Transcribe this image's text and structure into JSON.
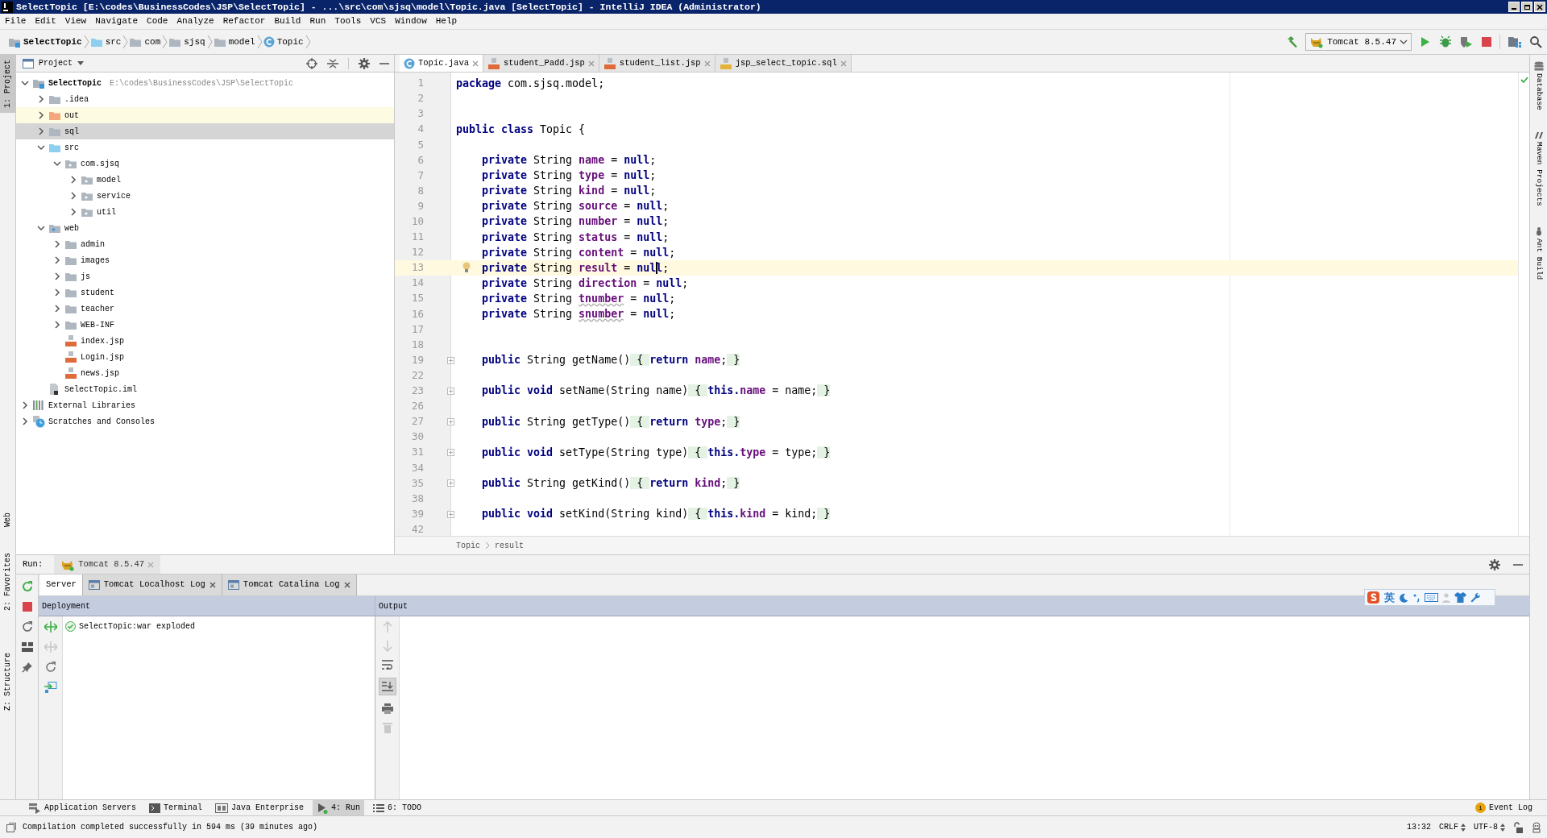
{
  "window": {
    "title": "SelectTopic [E:\\codes\\BusinessCodes\\JSP\\SelectTopic] - ...\\src\\com\\sjsq\\model\\Topic.java [SelectTopic] - IntelliJ IDEA (Administrator)"
  },
  "menu": [
    "File",
    "Edit",
    "View",
    "Navigate",
    "Code",
    "Analyze",
    "Refactor",
    "Build",
    "Run",
    "Tools",
    "VCS",
    "Window",
    "Help"
  ],
  "nav_bar": [
    {
      "label": "SelectTopic",
      "kind": "module"
    },
    {
      "label": "src",
      "kind": "source"
    },
    {
      "label": "com",
      "kind": "folder"
    },
    {
      "label": "sjsq",
      "kind": "folder"
    },
    {
      "label": "model",
      "kind": "folder"
    },
    {
      "label": "Topic",
      "kind": "class"
    }
  ],
  "run_config": "Tomcat 8.5.47",
  "left_stripe": [
    {
      "label": "1: Project",
      "selected": true
    },
    {
      "label": "Web",
      "selected": false
    },
    {
      "label": "2: Favorites",
      "selected": false
    },
    {
      "label": "Z: Structure",
      "selected": false
    }
  ],
  "right_stripe": [
    "Database",
    "Maven Projects",
    "Ant Build"
  ],
  "project": {
    "title": "Project",
    "tree": [
      {
        "label": "SelectTopic",
        "path": "E:\\codes\\BusinessCodes\\JSP\\SelectTopic",
        "kind": "module",
        "expanded": true,
        "selected": false,
        "children": [
          {
            "label": ".idea",
            "kind": "folder",
            "expanded": false,
            "selected": false
          },
          {
            "label": "out",
            "kind": "excluded",
            "expanded": false,
            "selected": false
          },
          {
            "label": "sql",
            "kind": "folder",
            "expanded": false,
            "selected": true
          },
          {
            "label": "src",
            "kind": "source",
            "expanded": true,
            "selected": false,
            "children": [
              {
                "label": "com.sjsq",
                "kind": "package",
                "expanded": true,
                "selected": false,
                "children": [
                  {
                    "label": "model",
                    "kind": "package",
                    "expanded": false,
                    "selected": false
                  },
                  {
                    "label": "service",
                    "kind": "package",
                    "expanded": false,
                    "selected": false
                  },
                  {
                    "label": "util",
                    "kind": "package",
                    "expanded": false,
                    "selected": false
                  }
                ]
              }
            ]
          },
          {
            "label": "web",
            "kind": "web",
            "expanded": true,
            "selected": false,
            "children": [
              {
                "label": "admin",
                "kind": "folder",
                "expanded": false,
                "selected": false
              },
              {
                "label": "images",
                "kind": "folder",
                "expanded": false,
                "selected": false
              },
              {
                "label": "js",
                "kind": "folder",
                "expanded": false,
                "selected": false
              },
              {
                "label": "student",
                "kind": "folder",
                "expanded": false,
                "selected": false
              },
              {
                "label": "teacher",
                "kind": "folder",
                "expanded": false,
                "selected": false
              },
              {
                "label": "WEB-INF",
                "kind": "folder",
                "expanded": false,
                "selected": false
              },
              {
                "label": "index.jsp",
                "kind": "jsp",
                "selected": false
              },
              {
                "label": "Login.jsp",
                "kind": "jsp",
                "selected": false
              },
              {
                "label": "news.jsp",
                "kind": "jsp",
                "selected": false
              }
            ]
          },
          {
            "label": "SelectTopic.iml",
            "kind": "iml",
            "selected": false
          }
        ]
      },
      {
        "label": "External Libraries",
        "kind": "libraries",
        "expanded": false,
        "selected": false
      },
      {
        "label": "Scratches and Consoles",
        "kind": "scratches",
        "expanded": false,
        "selected": false
      }
    ]
  },
  "editor_tabs": [
    {
      "label": "Topic.java",
      "kind": "class",
      "selected": true
    },
    {
      "label": "student_Padd.jsp",
      "kind": "jsp",
      "selected": false
    },
    {
      "label": "student_list.jsp",
      "kind": "jsp",
      "selected": false
    },
    {
      "label": "jsp_select_topic.sql",
      "kind": "sql",
      "selected": false
    }
  ],
  "code": [
    {
      "number": "1",
      "tokens": [
        {
          "kind": "kw",
          "text": "package"
        },
        {
          "kind": "plain",
          "text": " com.sjsq.model;"
        }
      ]
    },
    {
      "number": "2"
    },
    {
      "number": "3"
    },
    {
      "number": "4",
      "tokens": [
        {
          "kind": "kw",
          "text": "public class"
        },
        {
          "kind": "plain",
          "text": " Topic {"
        }
      ]
    },
    {
      "number": "5"
    },
    {
      "number": "6",
      "tokens": [
        {
          "kind": "kw",
          "text": "    private"
        },
        {
          "kind": "plain",
          "text": " String "
        },
        {
          "kind": "field",
          "text": "name"
        },
        {
          "kind": "plain",
          "text": " = "
        },
        {
          "kind": "kw",
          "text": "null"
        },
        {
          "kind": "plain",
          "text": ";"
        }
      ]
    },
    {
      "number": "7",
      "tokens": [
        {
          "kind": "kw",
          "text": "    private"
        },
        {
          "kind": "plain",
          "text": " String "
        },
        {
          "kind": "field",
          "text": "type"
        },
        {
          "kind": "plain",
          "text": " = "
        },
        {
          "kind": "kw",
          "text": "null"
        },
        {
          "kind": "plain",
          "text": ";"
        }
      ]
    },
    {
      "number": "8",
      "tokens": [
        {
          "kind": "kw",
          "text": "    private"
        },
        {
          "kind": "plain",
          "text": " String "
        },
        {
          "kind": "field",
          "text": "kind"
        },
        {
          "kind": "plain",
          "text": " = "
        },
        {
          "kind": "kw",
          "text": "null"
        },
        {
          "kind": "plain",
          "text": ";"
        }
      ]
    },
    {
      "number": "9",
      "tokens": [
        {
          "kind": "kw",
          "text": "    private"
        },
        {
          "kind": "plain",
          "text": " String "
        },
        {
          "kind": "field",
          "text": "source"
        },
        {
          "kind": "plain",
          "text": " = "
        },
        {
          "kind": "kw",
          "text": "null"
        },
        {
          "kind": "plain",
          "text": ";"
        }
      ]
    },
    {
      "number": "10",
      "tokens": [
        {
          "kind": "kw",
          "text": "    private"
        },
        {
          "kind": "plain",
          "text": " String "
        },
        {
          "kind": "field",
          "text": "number"
        },
        {
          "kind": "plain",
          "text": " = "
        },
        {
          "kind": "kw",
          "text": "null"
        },
        {
          "kind": "plain",
          "text": ";"
        }
      ]
    },
    {
      "number": "11",
      "tokens": [
        {
          "kind": "kw",
          "text": "    private"
        },
        {
          "kind": "plain",
          "text": " String "
        },
        {
          "kind": "field",
          "text": "status"
        },
        {
          "kind": "plain",
          "text": " = "
        },
        {
          "kind": "kw",
          "text": "null"
        },
        {
          "kind": "plain",
          "text": ";"
        }
      ]
    },
    {
      "number": "12",
      "tokens": [
        {
          "kind": "kw",
          "text": "    private"
        },
        {
          "kind": "plain",
          "text": " String "
        },
        {
          "kind": "field",
          "text": "content"
        },
        {
          "kind": "plain",
          "text": " = "
        },
        {
          "kind": "kw",
          "text": "null"
        },
        {
          "kind": "plain",
          "text": ";"
        }
      ]
    },
    {
      "number": "13",
      "current": true,
      "intention": true,
      "tokens": [
        {
          "kind": "kw",
          "text": "    private"
        },
        {
          "kind": "plain",
          "text": " String "
        },
        {
          "kind": "field",
          "text": "result"
        },
        {
          "kind": "plain",
          "text": " = "
        },
        {
          "kind": "kw",
          "text": "nul"
        },
        {
          "kind": "kw",
          "text": "l",
          "caret": true
        },
        {
          "kind": "plain",
          "text": ";"
        }
      ]
    },
    {
      "number": "14",
      "tokens": [
        {
          "kind": "kw",
          "text": "    private"
        },
        {
          "kind": "plain",
          "text": " String "
        },
        {
          "kind": "field",
          "text": "direction"
        },
        {
          "kind": "plain",
          "text": " = "
        },
        {
          "kind": "kw",
          "text": "null"
        },
        {
          "kind": "plain",
          "text": ";"
        }
      ]
    },
    {
      "number": "15",
      "tokens": [
        {
          "kind": "kw",
          "text": "    private"
        },
        {
          "kind": "plain",
          "text": " String "
        },
        {
          "kind": "typo",
          "text": "tnumber"
        },
        {
          "kind": "plain",
          "text": " = "
        },
        {
          "kind": "kw",
          "text": "null"
        },
        {
          "kind": "plain",
          "text": ";"
        }
      ]
    },
    {
      "number": "16",
      "tokens": [
        {
          "kind": "kw",
          "text": "    private"
        },
        {
          "kind": "plain",
          "text": " String "
        },
        {
          "kind": "typo",
          "text": "snumber"
        },
        {
          "kind": "plain",
          "text": " = "
        },
        {
          "kind": "kw",
          "text": "null"
        },
        {
          "kind": "plain",
          "text": ";"
        }
      ]
    },
    {
      "number": "17"
    },
    {
      "number": "18"
    },
    {
      "number": "19",
      "folded": true,
      "tokens": [
        {
          "kind": "kw",
          "text": "    public"
        },
        {
          "kind": "plain",
          "text": " String getName()"
        },
        {
          "kind": "fold",
          "text": " { "
        },
        {
          "kind": "kw",
          "text": "return "
        },
        {
          "kind": "field",
          "text": "name"
        },
        {
          "kind": "plain",
          "text": ";"
        },
        {
          "kind": "fold",
          "text": " }"
        }
      ]
    },
    {
      "number": "22"
    },
    {
      "number": "23",
      "folded": true,
      "tokens": [
        {
          "kind": "kw",
          "text": "    public void"
        },
        {
          "kind": "plain",
          "text": " setName(String name)"
        },
        {
          "kind": "fold",
          "text": " { "
        },
        {
          "kind": "kw",
          "text": "this."
        },
        {
          "kind": "field",
          "text": "name"
        },
        {
          "kind": "plain",
          "text": " = name;"
        },
        {
          "kind": "fold",
          "text": " }"
        }
      ]
    },
    {
      "number": "26"
    },
    {
      "number": "27",
      "folded": true,
      "tokens": [
        {
          "kind": "kw",
          "text": "    public"
        },
        {
          "kind": "plain",
          "text": " String getType()"
        },
        {
          "kind": "fold",
          "text": " { "
        },
        {
          "kind": "kw",
          "text": "return "
        },
        {
          "kind": "field",
          "text": "type"
        },
        {
          "kind": "plain",
          "text": ";"
        },
        {
          "kind": "fold",
          "text": " }"
        }
      ]
    },
    {
      "number": "30"
    },
    {
      "number": "31",
      "folded": true,
      "tokens": [
        {
          "kind": "kw",
          "text": "    public void"
        },
        {
          "kind": "plain",
          "text": " setType(String type)"
        },
        {
          "kind": "fold",
          "text": " { "
        },
        {
          "kind": "kw",
          "text": "this."
        },
        {
          "kind": "field",
          "text": "type"
        },
        {
          "kind": "plain",
          "text": " = type;"
        },
        {
          "kind": "fold",
          "text": " }"
        }
      ]
    },
    {
      "number": "34"
    },
    {
      "number": "35",
      "folded": true,
      "tokens": [
        {
          "kind": "kw",
          "text": "    public"
        },
        {
          "kind": "plain",
          "text": " String getKind()"
        },
        {
          "kind": "fold",
          "text": " { "
        },
        {
          "kind": "kw",
          "text": "return "
        },
        {
          "kind": "field",
          "text": "kind"
        },
        {
          "kind": "plain",
          "text": ";"
        },
        {
          "kind": "fold",
          "text": " }"
        }
      ]
    },
    {
      "number": "38"
    },
    {
      "number": "39",
      "folded": true,
      "tokens": [
        {
          "kind": "kw",
          "text": "    public void"
        },
        {
          "kind": "plain",
          "text": " setKind(String kind)"
        },
        {
          "kind": "fold",
          "text": " { "
        },
        {
          "kind": "kw",
          "text": "this."
        },
        {
          "kind": "field",
          "text": "kind"
        },
        {
          "kind": "plain",
          "text": " = kind;"
        },
        {
          "kind": "fold",
          "text": " }"
        }
      ]
    },
    {
      "number": "42"
    }
  ],
  "editor_breadcrumbs": [
    "Topic",
    "result"
  ],
  "run": {
    "label": "Run:",
    "tab": "Tomcat 8.5.47",
    "subtabs": [
      {
        "label": "Server",
        "selected": true
      },
      {
        "label": "Tomcat Localhost Log",
        "selected": false,
        "closable": true
      },
      {
        "label": "Tomcat Catalina Log",
        "selected": false,
        "closable": true
      }
    ],
    "deployment": {
      "title": "Deployment",
      "items": [
        {
          "label": "SelectTopic:war exploded",
          "kind": "success"
        }
      ]
    },
    "output": {
      "title": "Output",
      "scroll_to_end": true
    }
  },
  "tool_windows": [
    {
      "label": "Application Servers",
      "kind": "servers",
      "selected": false
    },
    {
      "label": "Terminal",
      "kind": "terminal",
      "selected": false
    },
    {
      "label": "Java Enterprise",
      "kind": "javaee",
      "selected": false
    },
    {
      "label": "4: Run",
      "kind": "run",
      "selected": true
    },
    {
      "label": "6: TODO",
      "kind": "todo",
      "selected": false
    }
  ],
  "event_log": {
    "label": "Event Log",
    "count": "1"
  },
  "status_bar": {
    "message": "Compilation completed successfully in 594 ms (39 minutes ago)",
    "position": "13:32",
    "line_separator": "CRLF",
    "encoding": "UTF-8"
  },
  "ime_bar": {
    "mode": "英"
  }
}
